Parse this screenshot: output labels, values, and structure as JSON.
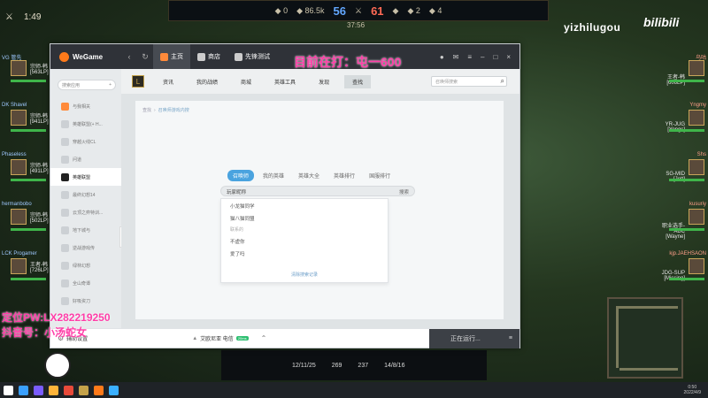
{
  "stream": {
    "game_clock": "1:49",
    "score_blue": "56",
    "score_red": "61",
    "game_timer": "37:56",
    "watermark": "yizhilugou",
    "bilibili": "bilibili",
    "pink_title": "目前在打：屯一600",
    "pink_bottom_1": "定位PW:LX282219250",
    "pink_bottom_2": "抖音号：小汤蛇女"
  },
  "players_left": [
    {
      "name": "VG 管先",
      "rank": "宗师-韩 [563LP]"
    },
    {
      "name": "DK Shavel",
      "rank": "宗师-韩 [941LP]"
    },
    {
      "name": "Phaseless",
      "rank": "宗师-韩 [491LP]"
    },
    {
      "name": "hermanbobo",
      "rank": "宗师-韩 [502LP]"
    },
    {
      "name": "LCK Progamer",
      "rank": "王者-韩 [726LP]"
    }
  ],
  "players_right": [
    {
      "name": "乌咕",
      "rank": "王者-韩 [606LP]"
    },
    {
      "name": "Yngmy",
      "rank": "YR-JUG [Yongs]"
    },
    {
      "name": "Shs",
      "rank": "SG-MID [Jett]"
    },
    {
      "name": "kusuriy",
      "rank": "职业选手-ADC [Wayne]"
    },
    {
      "name": "kjp.JAEHSAON",
      "rank": "JDG-SUP [Missing]"
    }
  ],
  "bottom_hud": {
    "kda": "12/11/25",
    "cs": "269",
    "kda2": "14/8/16",
    "cs2": "237"
  },
  "wegame": {
    "logo": "WeGame",
    "header_tabs": [
      {
        "label": "主页",
        "active": true
      },
      {
        "label": "商店",
        "active": false
      },
      {
        "label": "先锋测试",
        "active": false
      }
    ],
    "sidebar": {
      "search_placeholder": "搜索应用",
      "items": [
        {
          "label": "与我相关",
          "active": false
        },
        {
          "label": "英雄联盟(+ H...",
          "active": false
        },
        {
          "label": "穿越火线CL",
          "active": false
        },
        {
          "label": "问道",
          "active": false
        },
        {
          "label": "英雄联盟",
          "active": true
        },
        {
          "label": "最终幻想14",
          "active": false
        },
        {
          "label": "云顶之弈特训...",
          "active": false
        },
        {
          "label": "地下城与",
          "active": false
        },
        {
          "label": "逆战游戏传",
          "active": false
        },
        {
          "label": "绿林幻想",
          "active": false
        },
        {
          "label": "全山奇谭",
          "active": false
        },
        {
          "label": "好吸资刀",
          "active": false
        }
      ]
    },
    "lol_tabs": [
      {
        "label": "资讯",
        "active": false
      },
      {
        "label": "我的战绩",
        "active": false
      },
      {
        "label": "商城",
        "active": false
      },
      {
        "label": "英雄工具",
        "active": false
      },
      {
        "label": "发现",
        "active": false
      },
      {
        "label": "查找",
        "active": true
      }
    ],
    "lol_search_placeholder": "召唤师搜索",
    "breadcrumb": [
      "查找",
      "召唤师游戏内搜"
    ],
    "filter_tabs": [
      {
        "label": "召唤师",
        "active": true
      },
      {
        "label": "我的英雄",
        "active": false
      },
      {
        "label": "英雄大全",
        "active": false
      },
      {
        "label": "英雄排行",
        "active": false
      },
      {
        "label": "国服排行",
        "active": false
      }
    ],
    "search_value": "玩家昵称",
    "search_button": "搜索",
    "history": [
      "小龙猫同学",
      "猫八猫同盟"
    ],
    "history_section": "联系的",
    "friends": [
      "不虚你",
      "爱了吗"
    ],
    "clear_history": "清除搜索记录",
    "footer": {
      "settings": "辅助设置",
      "launch_game": "艾欧尼亚 电信",
      "badge": "20ms",
      "run_button": "正在运行..."
    }
  },
  "taskbar": {
    "time": "0:50",
    "date": "2022/4/9"
  }
}
